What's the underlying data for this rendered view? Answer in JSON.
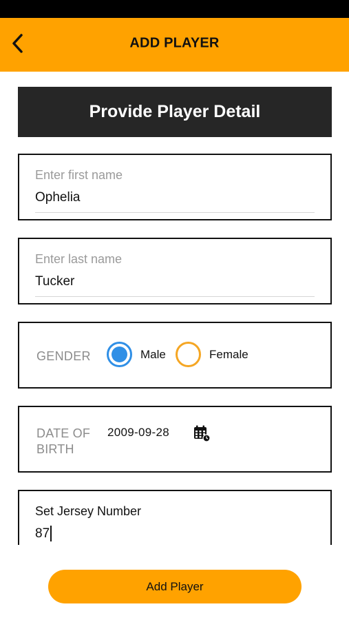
{
  "header": {
    "title": "ADD PLAYER",
    "back_icon": "chevron-left-icon",
    "background_color": "#ffa200"
  },
  "banner": {
    "title": "Provide Player Detail",
    "background_color": "#262626"
  },
  "first_name": {
    "placeholder": "Enter first name",
    "value": "Ophelia"
  },
  "last_name": {
    "placeholder": "Enter last name",
    "value": "Tucker"
  },
  "gender": {
    "label": "GENDER",
    "options": [
      "Male",
      "Female"
    ],
    "selected": "Male",
    "selected_color": "#2f8fe6",
    "unselected_color": "#f5a623"
  },
  "date_of_birth": {
    "label": "DATE OF BIRTH",
    "value": "2009-09-28",
    "icon": "calendar-icon"
  },
  "jersey": {
    "label": "Set Jersey Number",
    "value": "87"
  },
  "actions": {
    "add_label": "Add Player",
    "accent_color": "#ffa200"
  }
}
